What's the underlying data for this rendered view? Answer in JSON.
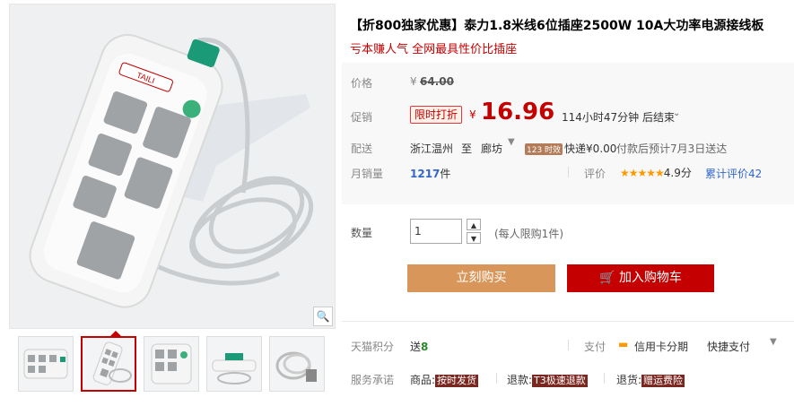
{
  "title": "【折800独家优惠】泰力1.8米线6位插座2500W 10A大功率电源接线板",
  "subtitle": "亏本赚人气 全网最具性价比插座",
  "price_row": {
    "label": "价格",
    "currency": "¥",
    "original": "64.00"
  },
  "promo_row": {
    "label": "促销",
    "badge": "限时打折",
    "currency": "¥",
    "price": "16.96",
    "countdown": "114小时47分钟 后结束"
  },
  "shipping_row": {
    "label": "配送",
    "from": "浙江温州",
    "to_word": "至",
    "dest": "廊坊",
    "badge": "123 时效",
    "fee": "快递¥0.00",
    "note": "付款后预计7月3日送达"
  },
  "sales_row": {
    "label": "月销量",
    "count": "1217",
    "unit": "件",
    "rating_label": "评价",
    "stars": "★★★★★",
    "score": "4.9分",
    "review_link": "累计评价42"
  },
  "qty_row": {
    "label": "数量",
    "value": "1",
    "limit": "(每人限购1件)"
  },
  "buttons": {
    "buy": "立刻购买",
    "cart": "加入购物车"
  },
  "points_row": {
    "label": "天猫积分",
    "send": "送",
    "points": "8",
    "pay_label": "支付",
    "credit": "信用卡分期",
    "quick": "快捷支付"
  },
  "service_row": {
    "label": "服务承诺",
    "goods_label": "商品:",
    "goods_tag": "按时发货",
    "refund_label": "退款:",
    "refund_tag": "T3极速退款",
    "return_label": "退货:",
    "return_tag": "赠运费险"
  },
  "brand": "TAILI",
  "colors": {
    "accent": "#c40000",
    "buy": "#d8965a",
    "panel": "#f8f8f8"
  },
  "icons": [
    "zoom-icon",
    "cart-icon",
    "credit-card-icon",
    "chevron-down-icon",
    "spin-up-icon",
    "spin-down-icon"
  ]
}
